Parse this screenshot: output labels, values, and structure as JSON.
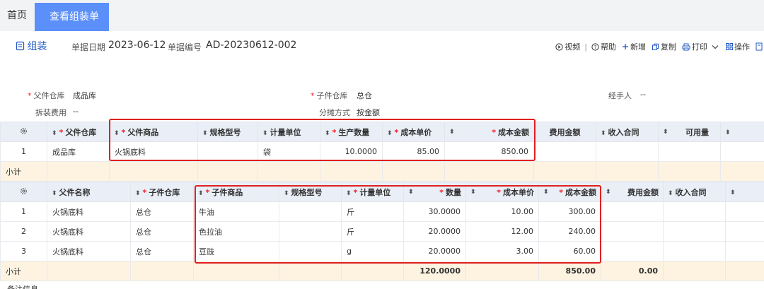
{
  "tabs": {
    "home": "首页",
    "active": "查看组装单",
    "close": "×"
  },
  "doc": {
    "tab_label": "组装",
    "date_label": "单据日期",
    "date_value": "2023-06-12",
    "no_label": "单据编号",
    "no_value": "AD-20230612-002"
  },
  "toolbar": {
    "video": "视频",
    "sep": "|",
    "help": "帮助",
    "add": "新增",
    "copy": "复制",
    "print": "打印",
    "ops": "操作"
  },
  "form": {
    "parent_wh_label": "父件仓库",
    "parent_wh_value": "成品库",
    "child_wh_label": "子件仓库",
    "child_wh_value": "总仓",
    "handler_label": "经手人",
    "handler_value": "--",
    "fee_label": "拆装费用",
    "fee_value": "--",
    "alloc_label": "分摊方式",
    "alloc_value": "按金额"
  },
  "table1": {
    "headers": [
      "父件仓库",
      "父件商品",
      "规格型号",
      "计量单位",
      "生产数量",
      "成本单价",
      "成本金额",
      "费用金额",
      "收入合同",
      "可用量"
    ],
    "rows": [
      {
        "idx": "1",
        "wh": "成品库",
        "item": "火锅底料",
        "spec": "",
        "unit": "袋",
        "qty": "10.0000",
        "price": "85.00",
        "amount": "850.00",
        "fee": "",
        "contract": "",
        "avail": ""
      }
    ],
    "subtotal_label": "小计"
  },
  "table2": {
    "headers": [
      "父件名称",
      "子件仓库",
      "子件商品",
      "规格型号",
      "计量单位",
      "数量",
      "成本单价",
      "成本金额",
      "费用金额",
      "收入合同"
    ],
    "rows": [
      {
        "idx": "1",
        "parent": "火锅底料",
        "wh": "总仓",
        "item": "牛油",
        "spec": "",
        "unit": "斤",
        "qty": "30.0000",
        "price": "10.00",
        "amount": "300.00",
        "fee": "",
        "contract": ""
      },
      {
        "idx": "2",
        "parent": "火锅底料",
        "wh": "总仓",
        "item": "色拉油",
        "spec": "",
        "unit": "斤",
        "qty": "20.0000",
        "price": "12.00",
        "amount": "240.00",
        "fee": "",
        "contract": ""
      },
      {
        "idx": "3",
        "parent": "火锅底料",
        "wh": "总仓",
        "item": "豆豉",
        "spec": "",
        "unit": "g",
        "qty": "20.0000",
        "price": "3.00",
        "amount": "60.00",
        "fee": "",
        "contract": ""
      }
    ],
    "subtotal_label": "小计",
    "subtotal_qty": "120.0000",
    "subtotal_amount": "850.00",
    "subtotal_fee": "0.00"
  },
  "footer": {
    "text": "备注信息"
  },
  "colors": {
    "accent": "#5b8ff9",
    "header_bg": "#e9eef7",
    "subtotal_bg": "#fdf3e0",
    "highlight": "#e02020"
  }
}
